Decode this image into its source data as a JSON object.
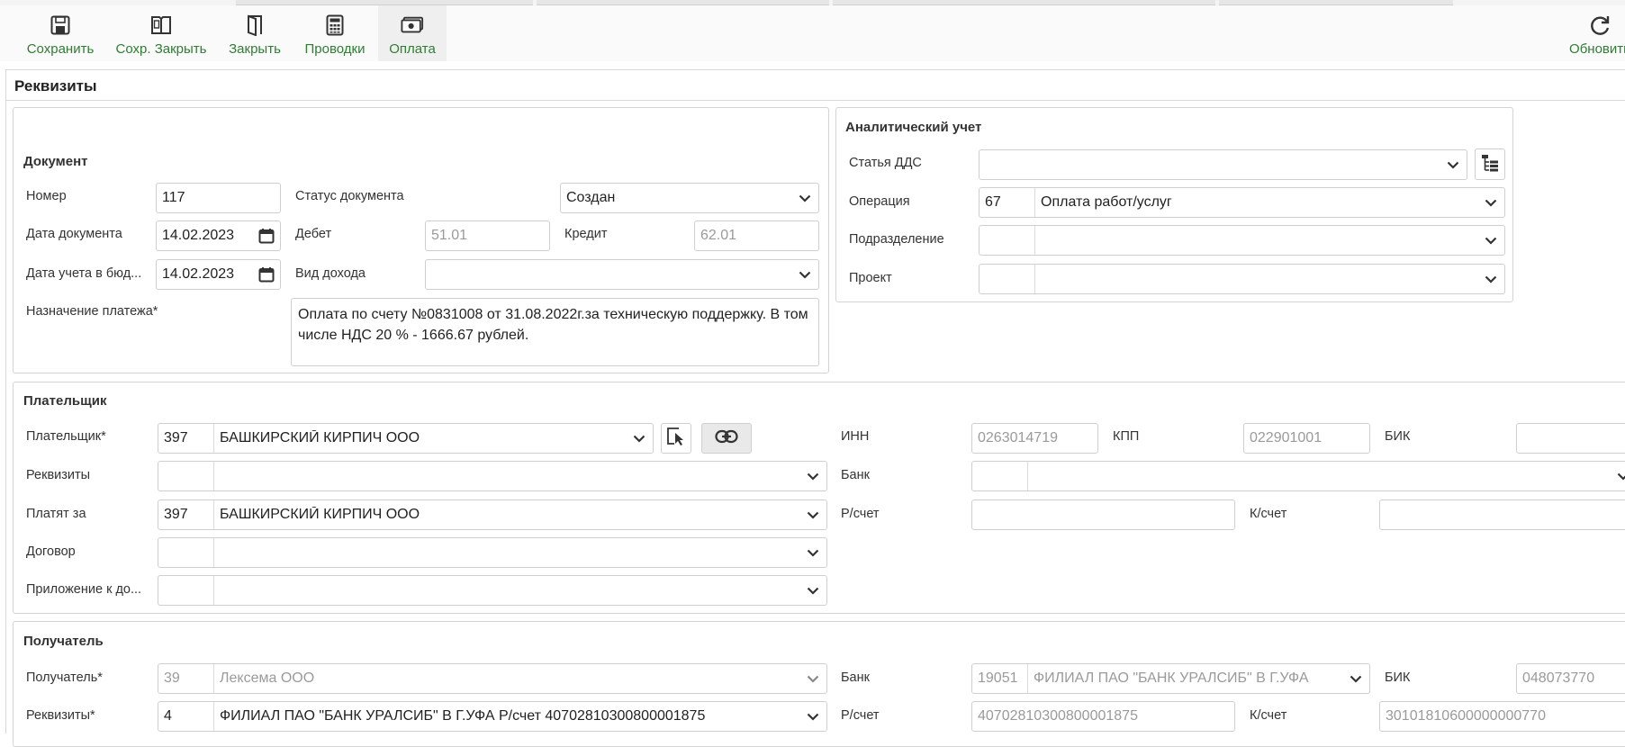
{
  "toolbar": {
    "save": "Сохранить",
    "save_close": "Сохр. Закрыть",
    "close": "Закрыть",
    "postings": "Проводки",
    "payment": "Оплата",
    "refresh": "Обновить"
  },
  "panel_title": "Реквизиты",
  "document": {
    "title": "Документ",
    "number_label": "Номер",
    "number": "117",
    "status_label": "Статус документа",
    "status": "Создан",
    "date_label": "Дата документа",
    "date": "14.02.2023",
    "debit_label": "Дебет",
    "debit": "51.01",
    "credit_label": "Кредит",
    "credit": "62.01",
    "budget_date_label": "Дата учета в бюд...",
    "budget_date": "14.02.2023",
    "income_type_label": "Вид дохода",
    "income_type": "",
    "purpose_label": "Назначение платежа*",
    "purpose": "Оплата по счету №0831008 от 31.08.2022г.за техническую поддержку. В том числе НДС 20 % - 1666.67 рублей."
  },
  "analytics": {
    "title": "Аналитический учет",
    "dds_label": "Статья ДДС",
    "dds": "",
    "operation_label": "Операция",
    "operation_code": "67",
    "operation": "Оплата работ/услуг",
    "department_label": "Подразделение",
    "department_code": "",
    "department": "",
    "project_label": "Проект",
    "project_code": "",
    "project": ""
  },
  "payer": {
    "title": "Плательщик",
    "payer_label": "Плательщик*",
    "payer_code": "397",
    "payer_name": "БАШКИРСКИЙ КИРПИЧ ООО",
    "details_label": "Реквизиты",
    "details_code": "",
    "details": "",
    "pay_for_label": "Платят за",
    "pay_for_code": "397",
    "pay_for_name": "БАШКИРСКИЙ КИРПИЧ ООО",
    "contract_label": "Договор",
    "contract_code": "",
    "contract": "",
    "appendix_label": "Приложение к до...",
    "appendix_code": "",
    "appendix": "",
    "inn_label": "ИНН",
    "inn": "0263014719",
    "kpp_label": "КПП",
    "kpp": "022901001",
    "bik_label": "БИК",
    "bik": "",
    "bank_label": "Банк",
    "bank_code": "",
    "bank": "",
    "account_label": "Р/счет",
    "account": "",
    "corr_label": "К/счет",
    "corr": ""
  },
  "recipient": {
    "title": "Получатель",
    "recipient_label": "Получатель*",
    "recipient_code": "39",
    "recipient_name": "Лексема ООО",
    "details_label": "Реквизиты*",
    "details_code": "4",
    "details": "ФИЛИАЛ ПАО \"БАНК УРАЛСИБ\" В Г.УФА Р/счет 40702810300800001875",
    "bank_label": "Банк",
    "bank_code": "19051",
    "bank": "ФИЛИАЛ ПАО \"БАНК УРАЛСИБ\" В Г.УФА",
    "bik_label": "БИК",
    "bik": "048073770",
    "account_label": "Р/счет",
    "account": "40702810300800001875",
    "corr_label": "К/счет",
    "corr": "30101810600000000770"
  },
  "colors": {
    "toolbar_text": "#2e7d32",
    "border": "#d4d4d4",
    "readonly_text": "#9a9a9a"
  }
}
